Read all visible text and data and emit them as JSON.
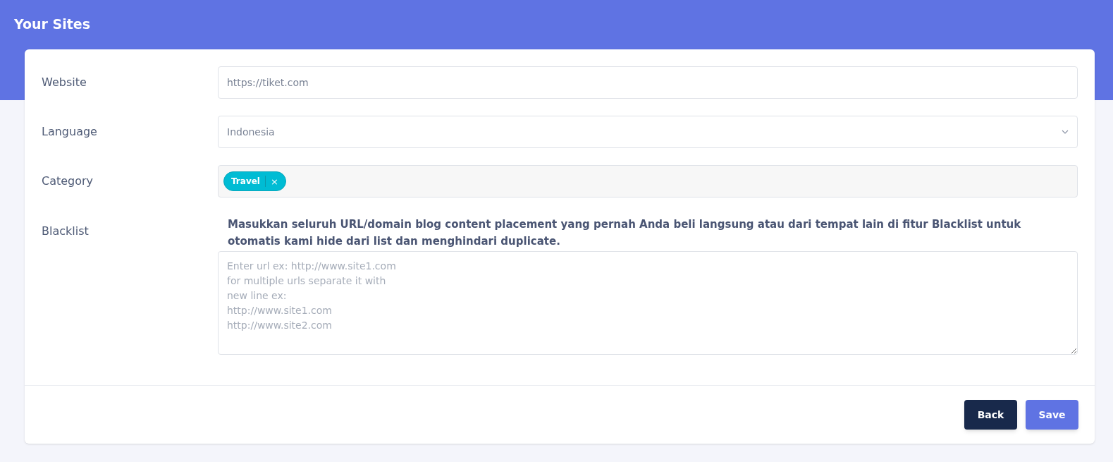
{
  "header": {
    "title": "Your Sites"
  },
  "form": {
    "website": {
      "label": "Website",
      "value": "https://tiket.com"
    },
    "language": {
      "label": "Language",
      "value": "Indonesia"
    },
    "category": {
      "label": "Category",
      "tags": [
        {
          "label": "Travel",
          "remove": "×"
        }
      ]
    },
    "blacklist": {
      "label": "Blacklist",
      "note": "Masukkan seluruh URL/domain blog content placement yang pernah Anda beli langsung atau dari tempat lain di fitur Blacklist untuk otomatis kami hide dari list dan menghindari duplicate.",
      "placeholder": "Enter url ex: http://www.site1.com\nfor multiple urls separate it with\nnew line ex:\nhttp://www.site1.com\nhttp://www.site2.com"
    }
  },
  "buttons": [
    {
      "label": "Back",
      "kind": "secondary"
    },
    {
      "label": "Save",
      "kind": "primary"
    }
  ]
}
